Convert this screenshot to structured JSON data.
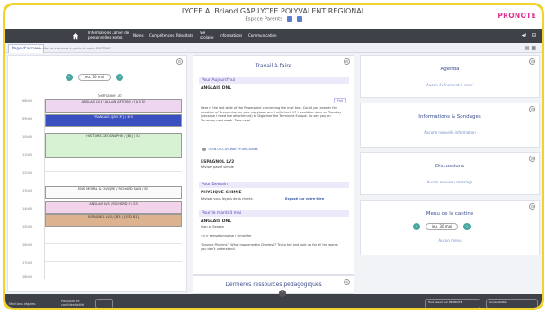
{
  "header": {
    "school": "LYCEE A. Briand GAP LYCEE POLYVALENT REGIONAL",
    "space": "Espace Parents",
    "logo": "PRONOTE"
  },
  "nav": {
    "items": [
      "Informations personnelles",
      "Cahier de textes",
      "Notes",
      "Compétences",
      "Résultats",
      "Vie scolaire",
      "Informations",
      "Communication"
    ]
  },
  "tabs": {
    "active": "Page d'accueil",
    "other": "Consultez et saisissez à partir de votre ENT/EMS"
  },
  "schedule": {
    "date": "jeu. 30 mai",
    "week": "Semaine 35",
    "times": [
      "08h00",
      "09h00",
      "10h00",
      "11h00",
      "12h00",
      "13h00",
      "14h00",
      "15h00",
      "16h00",
      "17h00",
      "18h00"
    ],
    "courses": [
      {
        "label": "ANGLAIS LV1 / ALLAIN ANTOINE / [A B S]",
        "color": "#efd6f0"
      },
      {
        "label": "FRANÇAIS / [B3 3F] / 3E3",
        "color": "#3a4fc0"
      },
      {
        "label": "HISTOIRE-GÉOGRAPHIE / [B2] / S3",
        "color": "#d6f2d3"
      },
      {
        "label": "ENS. MORAL & CIVIQUE / RICHARD SAIN / B3",
        "color": "#fafafa"
      },
      {
        "label": "ANGLAIS LV1 / RICHARD S / S3",
        "color": "#f2d3e9"
      },
      {
        "label": "ESPAGNOL LV2 / [B3] / [S3D B1]",
        "color": "#dcb28f"
      }
    ]
  },
  "work": {
    "title": "Travail à faire",
    "today_label": "Pour Aujourd'hui",
    "s1_subject": "ANGLAIS DNL",
    "s1_badge": "Fait",
    "s1_text": "Here is the last slide of the Powerpoint concerning the mist test. Could you answer the question of Dresslinhor on your copybook and I will check it? I would be done on Tuesday (because I need the attachment) to Digonhor the Terminale Europe. So see you on Thursday next week. Take care!",
    "s1_file": "TI-SN-03-Civil-War-PP-last-slides",
    "s2_subject": "ESPAGNOL LV2",
    "s2_text": "Réviser passé simple",
    "tomorrow_label": "Pour Demain",
    "s3_subject": "PHYSIQUE-CHIMIE",
    "s3_text": "Révisez vous leçons de la chimie.",
    "s3_link": "Exposé sur votre titre",
    "s4_label": "Pour le mardi 4 mai",
    "s4_subject": "ANGLAIS DNL",
    "s4_line1": "Sign of Season",
    "s4_line2": ">>> sensationnalise / simplifier",
    "s4_line3": "\"George Pilgrims\": What happened to Charles I? Try to tell and look up for all the words you don't understand.",
    "resources_title": "Dernières ressources pédagogiques"
  },
  "right": {
    "agenda_title": "Agenda",
    "agenda_empty": "Aucun événement à venir",
    "info_title": "Informations & Sondages",
    "info_empty": "Aucune nouvelle information",
    "disc_title": "Discussions",
    "disc_empty": "Aucun nouveau message",
    "menu_title": "Menu de la cantine",
    "menu_date": "jeu. 30 mai",
    "menu_empty": "Aucun menu"
  },
  "footer": {
    "left": "Mentions légales",
    "mid": "Politique de confidentialité",
    "app": "Tout savoir sur PRONOTE",
    "access": "Accessibilité"
  }
}
